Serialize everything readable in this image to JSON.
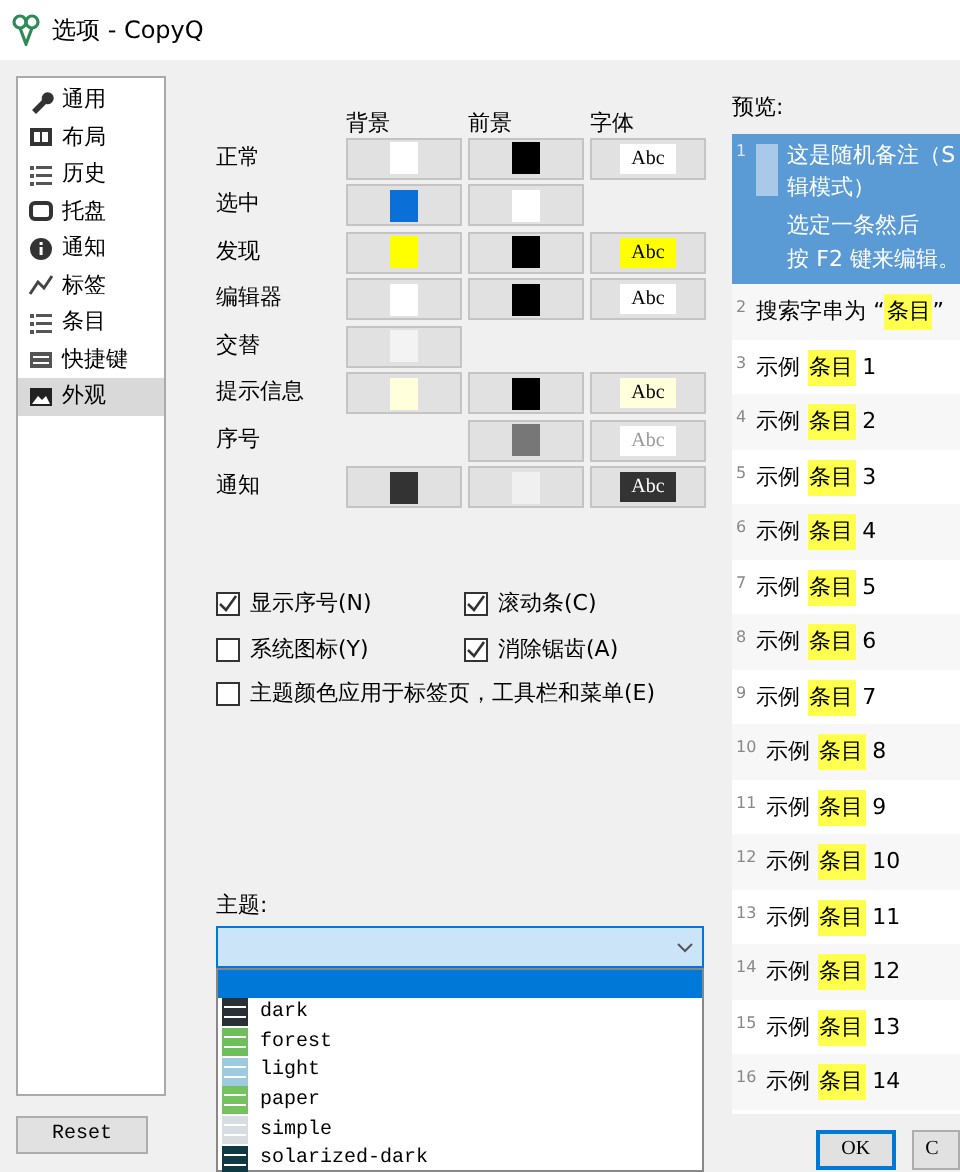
{
  "window": {
    "title": "选项 - CopyQ"
  },
  "sidebar": {
    "items": [
      {
        "label": "通用",
        "selected": false
      },
      {
        "label": "布局",
        "selected": false
      },
      {
        "label": "历史",
        "selected": false
      },
      {
        "label": "托盘",
        "selected": false
      },
      {
        "label": "通知",
        "selected": false
      },
      {
        "label": "标签",
        "selected": false
      },
      {
        "label": "条目",
        "selected": false
      },
      {
        "label": "快捷键",
        "selected": false
      },
      {
        "label": "外观",
        "selected": true
      }
    ]
  },
  "reset_button": "Reset",
  "colors": {
    "columns": [
      "背景",
      "前景",
      "字体"
    ],
    "rows": [
      {
        "label": "正常",
        "background": {
          "color": "#ffffff"
        },
        "foreground": {
          "color": "#000000"
        },
        "font": {
          "text": "Abc",
          "color": "#ffffff"
        }
      },
      {
        "label": "选中",
        "background": {
          "color": "#0a6fd6"
        },
        "foreground": {
          "color": "#ffffff"
        },
        "font": null
      },
      {
        "label": "发现",
        "background": {
          "color": "#ffff00"
        },
        "foreground": {
          "color": "#000000"
        },
        "font": {
          "text": "Abc",
          "color": "#ffff00"
        }
      },
      {
        "label": "编辑器",
        "background": {
          "color": "#ffffff"
        },
        "foreground": {
          "color": "#000000"
        },
        "font": {
          "text": "Abc",
          "color": "#ffffff"
        }
      },
      {
        "label": "交替",
        "background": {
          "color": "#f3f3f3"
        },
        "foreground": null,
        "font": null
      },
      {
        "label": "提示信息",
        "background": {
          "color": "#ffffdc"
        },
        "foreground": {
          "color": "#000000"
        },
        "font": {
          "text": "Abc",
          "color": "#ffffdc"
        }
      },
      {
        "label": "序号",
        "background": null,
        "foreground": {
          "color": "#777777"
        },
        "font": {
          "text": "Abc",
          "color": "#ffffff"
        }
      },
      {
        "label": "通知",
        "background": {
          "color": "#333333"
        },
        "foreground": {
          "color": "#f0f0f0"
        },
        "font": {
          "text": "Abc",
          "color": "#333333"
        }
      }
    ]
  },
  "options": [
    {
      "label": "显示序号(N)",
      "checked": true
    },
    {
      "label": "滚动条(C)",
      "checked": true
    },
    {
      "label": "系统图标(Y)",
      "checked": false
    },
    {
      "label": "消除锯齿(A)",
      "checked": true
    },
    {
      "label": "主题颜色应用于标签页，工具栏和菜单(E)",
      "checked": false
    }
  ],
  "theme": {
    "label": "主题:",
    "items": [
      {
        "label": "dark",
        "color": "#2b3036"
      },
      {
        "label": "forest",
        "color": "#6cbf5a"
      },
      {
        "label": "light",
        "color": "#9ccbe0"
      },
      {
        "label": "paper",
        "color": "#74c35e"
      },
      {
        "label": "simple",
        "color": "#d8dde2"
      },
      {
        "label": "solarized-dark",
        "color": "#0f3a44"
      }
    ]
  },
  "preview": {
    "label": "预览:",
    "items": [
      {
        "number": "1",
        "kind": "note",
        "selected": true,
        "lines": [
          "这是随机备注（S",
          "辑模式）"
        ],
        "text2": [
          "选定一条然后",
          "按 F2 键来编辑。"
        ]
      },
      {
        "number": "2",
        "kind": "match",
        "selected": false,
        "before": "搜索字串为 “",
        "match": "条目",
        "after": "”"
      },
      {
        "number": "3",
        "kind": "match",
        "selected": false,
        "before": "示例 ",
        "match": "条目",
        "after": " 1"
      },
      {
        "number": "4",
        "kind": "match",
        "selected": false,
        "before": "示例 ",
        "match": "条目",
        "after": " 2"
      },
      {
        "number": "5",
        "kind": "match",
        "selected": false,
        "before": "示例 ",
        "match": "条目",
        "after": " 3"
      },
      {
        "number": "6",
        "kind": "match",
        "selected": false,
        "before": "示例 ",
        "match": "条目",
        "after": " 4"
      },
      {
        "number": "7",
        "kind": "match",
        "selected": false,
        "before": "示例 ",
        "match": "条目",
        "after": " 5"
      },
      {
        "number": "8",
        "kind": "match",
        "selected": false,
        "before": "示例 ",
        "match": "条目",
        "after": " 6"
      },
      {
        "number": "9",
        "kind": "match",
        "selected": false,
        "before": "示例 ",
        "match": "条目",
        "after": " 7"
      },
      {
        "number": "10",
        "kind": "match",
        "selected": false,
        "before": "示例 ",
        "match": "条目",
        "after": " 8"
      },
      {
        "number": "11",
        "kind": "match",
        "selected": false,
        "before": "示例 ",
        "match": "条目",
        "after": " 9"
      },
      {
        "number": "12",
        "kind": "match",
        "selected": false,
        "before": "示例 ",
        "match": "条目",
        "after": " 10"
      },
      {
        "number": "13",
        "kind": "match",
        "selected": false,
        "before": "示例 ",
        "match": "条目",
        "after": " 11"
      },
      {
        "number": "14",
        "kind": "match",
        "selected": false,
        "before": "示例 ",
        "match": "条目",
        "after": " 12"
      },
      {
        "number": "15",
        "kind": "match",
        "selected": false,
        "before": "示例 ",
        "match": "条目",
        "after": " 13"
      },
      {
        "number": "16",
        "kind": "match",
        "selected": false,
        "before": "示例 ",
        "match": "条目",
        "after": " 14"
      }
    ]
  },
  "buttons": [
    "OK",
    "C"
  ]
}
